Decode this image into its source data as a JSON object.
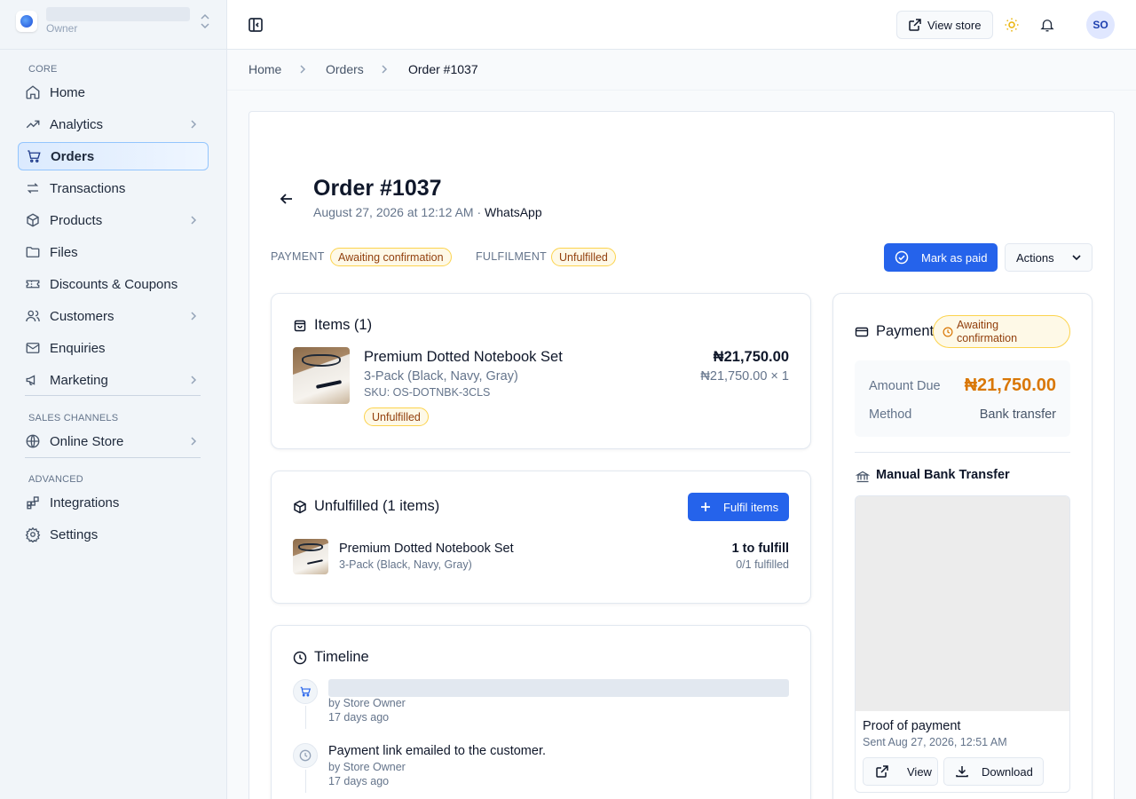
{
  "store": {
    "role": "Owner"
  },
  "sidebar": {
    "sections": {
      "core": "CORE",
      "sales_channels": "SALES CHANNELS",
      "advanced": "ADVANCED"
    },
    "items": [
      {
        "label": "Home",
        "icon": "home-icon"
      },
      {
        "label": "Analytics",
        "icon": "trending-up-icon",
        "expandable": true
      },
      {
        "label": "Orders",
        "icon": "cart-icon",
        "active": true
      },
      {
        "label": "Transactions",
        "icon": "swap-icon"
      },
      {
        "label": "Products",
        "icon": "box-icon",
        "expandable": true
      },
      {
        "label": "Files",
        "icon": "folder-icon"
      },
      {
        "label": "Discounts & Coupons",
        "icon": "ticket-icon"
      },
      {
        "label": "Customers",
        "icon": "users-icon",
        "expandable": true
      },
      {
        "label": "Enquiries",
        "icon": "mail-icon"
      },
      {
        "label": "Marketing",
        "icon": "megaphone-icon",
        "expandable": true
      },
      {
        "label": "Online Store",
        "icon": "globe-icon",
        "expandable": true
      },
      {
        "label": "Integrations",
        "icon": "blocks-icon"
      },
      {
        "label": "Settings",
        "icon": "gear-icon"
      }
    ]
  },
  "header": {
    "view_store": "View store",
    "avatar_initials": "SO"
  },
  "breadcrumb": [
    "Home",
    "Orders",
    "Order #1037"
  ],
  "order": {
    "title": "Order #1037",
    "date": "August 27, 2026 at 12:12 AM",
    "separator": "·",
    "channel": "WhatsApp",
    "payment_label": "PAYMENT",
    "payment_status": "Awaiting confirmation",
    "fulfilment_label": "FULFILMENT",
    "fulfilment_status": "Unfulfilled",
    "mark_paid": "Mark as paid",
    "actions": "Actions"
  },
  "items_card": {
    "title": "Items (1)",
    "product_name": "Premium Dotted Notebook Set",
    "variant": "3-Pack (Black, Navy, Gray)",
    "sku": "SKU: OS-DOTNBK-3CLS",
    "status": "Unfulfilled",
    "total": "₦21,750.00",
    "unit_line": "₦21,750.00 × 1"
  },
  "unfulfilled_card": {
    "title": "Unfulfilled (1 items)",
    "button": "Fulfil items",
    "product_name": "Premium Dotted Notebook Set",
    "variant": "3-Pack (Black, Navy, Gray)",
    "qty": "1 to fulfill",
    "progress": "0/1 fulfilled"
  },
  "timeline": {
    "title": "Timeline",
    "events": [
      {
        "text": "",
        "by": "by Store Owner",
        "when": "17 days ago",
        "icon": "cart-icon"
      },
      {
        "text": "Payment link emailed to the customer.",
        "by": "by Store Owner",
        "when": "17 days ago",
        "icon": "clock-icon"
      }
    ]
  },
  "payment_card": {
    "title": "Payment",
    "status": "Awaiting confirmation",
    "amount_label": "Amount Due",
    "amount": "₦21,750.00",
    "method_label": "Method",
    "method": "Bank transfer",
    "transfer_title": "Manual Bank Transfer",
    "proof_title": "Proof of payment",
    "proof_sent": "Sent Aug 27, 2026, 12:51 AM",
    "view": "View",
    "download": "Download"
  },
  "colors": {
    "accent": "#2563eb",
    "amount": "#d97706",
    "badge_bg": "#fef9e7",
    "badge_border": "#fcd34d"
  }
}
